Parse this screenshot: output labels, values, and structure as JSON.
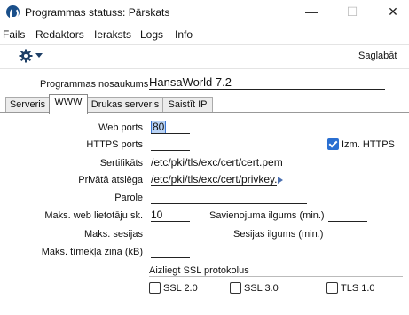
{
  "window": {
    "title": "Programmas statuss: Pārskats",
    "minimize": "—",
    "maximize": "☐",
    "close": "✕"
  },
  "menu": [
    "Fails",
    "Redaktors",
    "Ieraksts",
    "Logs",
    "Info"
  ],
  "toolbar": {
    "save_label": "Saglabāt",
    "settings_icon": "gear-icon"
  },
  "program_name": {
    "label": "Programmas nosaukums",
    "value": "HansaWorld 7.2"
  },
  "tabs": [
    "Serveris",
    "WWW",
    "Drukas serveris",
    "Saistīt IP"
  ],
  "active_tab": "WWW",
  "form": {
    "web_port": {
      "label": "Web ports",
      "value": "80"
    },
    "https_port": {
      "label": "HTTPS ports",
      "value": ""
    },
    "use_https": {
      "label": "Izm. HTTPS",
      "checked": true
    },
    "certificate": {
      "label": "Sertifikāts",
      "value": "/etc/pki/tls/exc/cert/cert.pem"
    },
    "private_key": {
      "label": "Privātā atslēga",
      "value": "/etc/pki/tls/exc/cert/privkey."
    },
    "password": {
      "label": "Parole",
      "value": ""
    },
    "max_web_users": {
      "label": "Maks. web lietotāju sk.",
      "value": "10"
    },
    "connection_length": {
      "label": "Savienojuma ilgums (min.)",
      "value": ""
    },
    "max_sessions": {
      "label": "Maks. sesijas",
      "value": ""
    },
    "session_length": {
      "label": "Sesijas ilgums (min.)",
      "value": ""
    },
    "max_message": {
      "label": "Maks. tīmekļa ziņa (kB)",
      "value": ""
    }
  },
  "ssl_group": {
    "label": "Aizliegt SSL protokolus",
    "options": [
      {
        "label": "SSL 2.0",
        "checked": false
      },
      {
        "label": "SSL 3.0",
        "checked": false
      },
      {
        "label": "TLS 1.0",
        "checked": false
      }
    ]
  }
}
